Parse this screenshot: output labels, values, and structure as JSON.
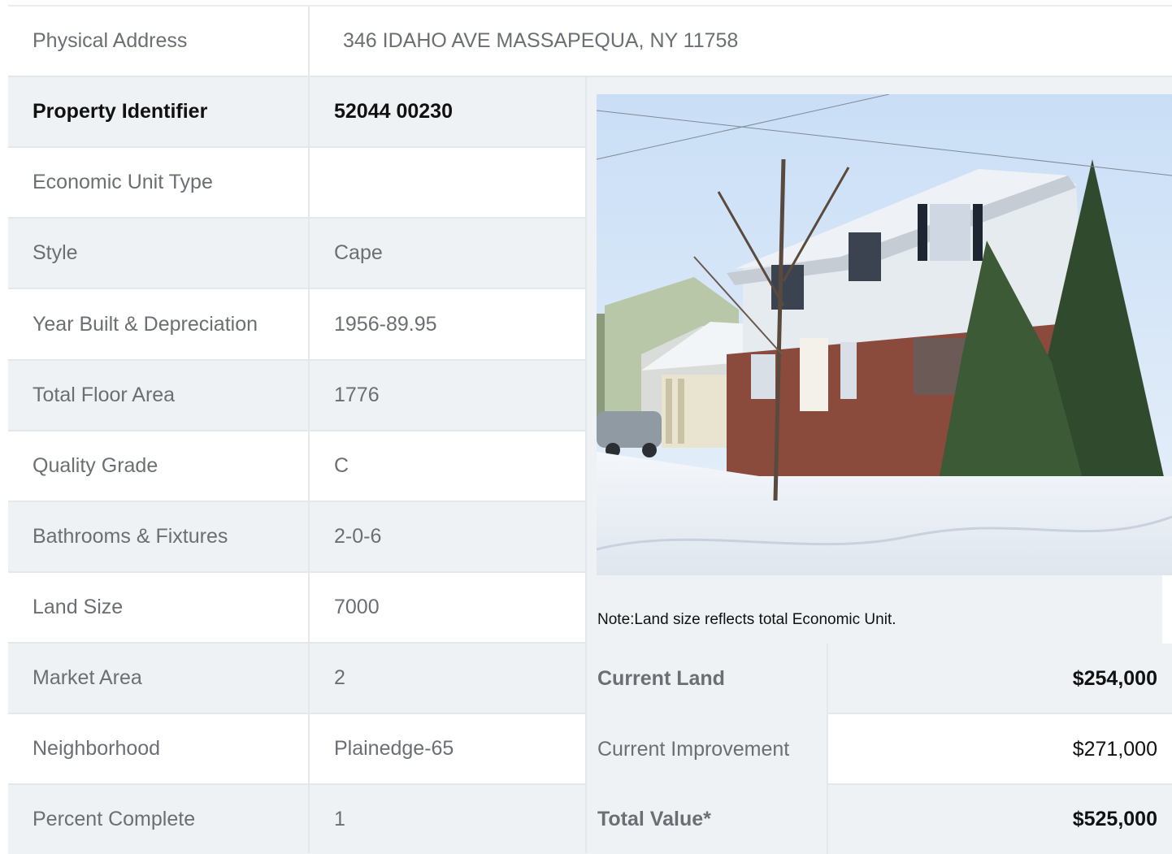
{
  "address": {
    "label": "Physical Address",
    "value": "346  IDAHO AVE  MASSAPEQUA, NY  11758"
  },
  "details": [
    {
      "label": "Property Identifier",
      "value": "52044  00230"
    },
    {
      "label": "Economic Unit Type",
      "value": ""
    },
    {
      "label": "Style",
      "value": "Cape"
    },
    {
      "label": "Year Built & Depreciation",
      "value": "1956-89.95"
    },
    {
      "label": "Total Floor Area",
      "value": "1776"
    },
    {
      "label": "Quality Grade",
      "value": "C"
    },
    {
      "label": "Bathrooms & Fixtures",
      "value": "2-0-6"
    },
    {
      "label": "Land Size",
      "value": "7000"
    },
    {
      "label": "Market Area",
      "value": "2"
    },
    {
      "label": "Neighborhood",
      "value": "Plainedge-65"
    },
    {
      "label": "Percent Complete",
      "value": "1"
    }
  ],
  "note": "Note:Land size reflects total Economic Unit.",
  "values": [
    {
      "label": "Current Land",
      "value": "$254,000"
    },
    {
      "label": "Current Improvement",
      "value": "$271,000"
    },
    {
      "label": "Total Value*",
      "value": "$525,000"
    }
  ],
  "colors": {
    "stripe": "#eff2f5",
    "border": "#e3e8ed",
    "text_muted": "#6b6f73",
    "text_strong": "#111111"
  }
}
